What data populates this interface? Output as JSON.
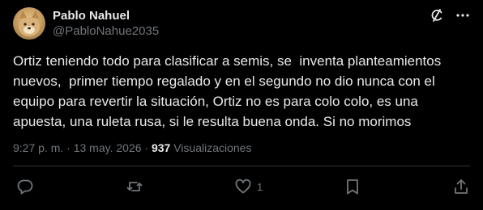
{
  "author": {
    "display_name": "Pablo Nahuel",
    "handle": "@PabloNahue2035"
  },
  "post": {
    "text": "Ortiz teniendo todo para clasificar a semis, se  inventa planteamientos\nnuevos,  primer tiempo regalado y en el segundo no dio nunca con el\nequipo para revertir la situación, Ortiz no es para colo colo, es una\napuesta, una ruleta rusa, si le resulta buena onda. Si no morimos",
    "time": "9:27 p. m.",
    "separator": " · ",
    "date": "13 may. 2026",
    "views_count": "937",
    "views_label": "Visualizaciones"
  },
  "actions": {
    "like_count": "1"
  },
  "icons": {
    "top": [
      "grok-icon",
      "more-options-icon"
    ],
    "actions": [
      "reply-icon",
      "repost-icon",
      "like-icon",
      "bookmark-icon",
      "share-icon"
    ]
  },
  "colors": {
    "background": "#000000",
    "text_primary": "#e7e9ea",
    "text_secondary": "#71767b",
    "divider": "#2f3336"
  }
}
